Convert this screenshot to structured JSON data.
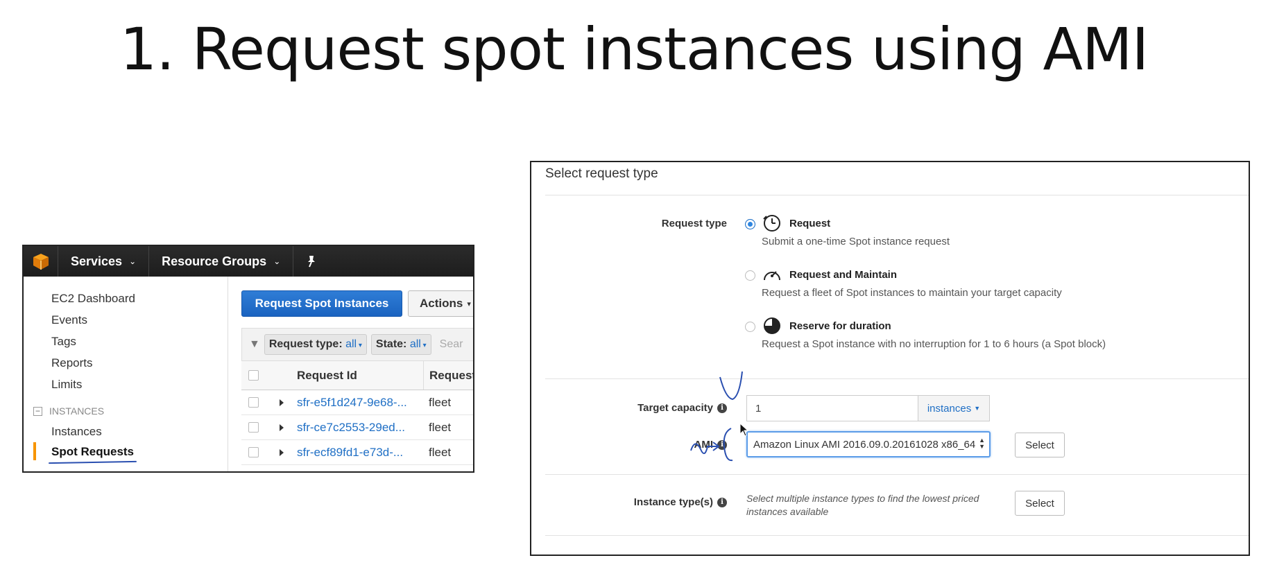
{
  "slide": {
    "title": "1.  Request spot instances using AMI"
  },
  "ec2": {
    "topbar": {
      "services": "Services",
      "resource_groups": "Resource Groups"
    },
    "sidebar": {
      "items": [
        "EC2 Dashboard",
        "Events",
        "Tags",
        "Reports",
        "Limits"
      ],
      "section": "INSTANCES",
      "section_items": [
        "Instances",
        "Spot Requests"
      ]
    },
    "toolbar": {
      "primary": "Request Spot Instances",
      "actions": "Actions"
    },
    "filters": {
      "request_type_label": "Request type:",
      "request_type_value": "all",
      "state_label": "State:",
      "state_value": "all",
      "search_placeholder": "Sear"
    },
    "table": {
      "headers": [
        "Request Id",
        "Request"
      ],
      "rows": [
        {
          "id": "sfr-e5f1d247-9e68-...",
          "type": "fleet"
        },
        {
          "id": "sfr-ce7c2553-29ed...",
          "type": "fleet"
        },
        {
          "id": "sfr-ecf89fd1-e73d-...",
          "type": "fleet"
        }
      ]
    }
  },
  "form": {
    "heading": "Select request type",
    "request_type_label": "Request type",
    "options": [
      {
        "title": "Request",
        "desc": "Submit a one-time Spot instance request",
        "selected": true
      },
      {
        "title": "Request and Maintain",
        "desc": "Request a fleet of Spot instances to maintain your target capacity",
        "selected": false
      },
      {
        "title": "Reserve for duration",
        "desc": "Request a Spot instance with no interruption for 1 to 6 hours (a Spot block)",
        "selected": false
      }
    ],
    "target_capacity": {
      "label": "Target capacity",
      "value": "1",
      "unit": "instances"
    },
    "ami": {
      "label": "AMI",
      "value": "Amazon Linux AMI 2016.09.0.20161028 x86_64",
      "button": "Select"
    },
    "instance_types": {
      "label": "Instance type(s)",
      "hint_line1": "Select multiple instance types to find the lowest priced",
      "hint_line2": "instances available",
      "button": "Select"
    }
  },
  "colors": {
    "accent": "#1f6fc5",
    "primary_button": "#1a63c0",
    "active_marker": "#f79400",
    "topbar": "#1d1d1d",
    "annotation_ink": "#2a4fb0"
  }
}
